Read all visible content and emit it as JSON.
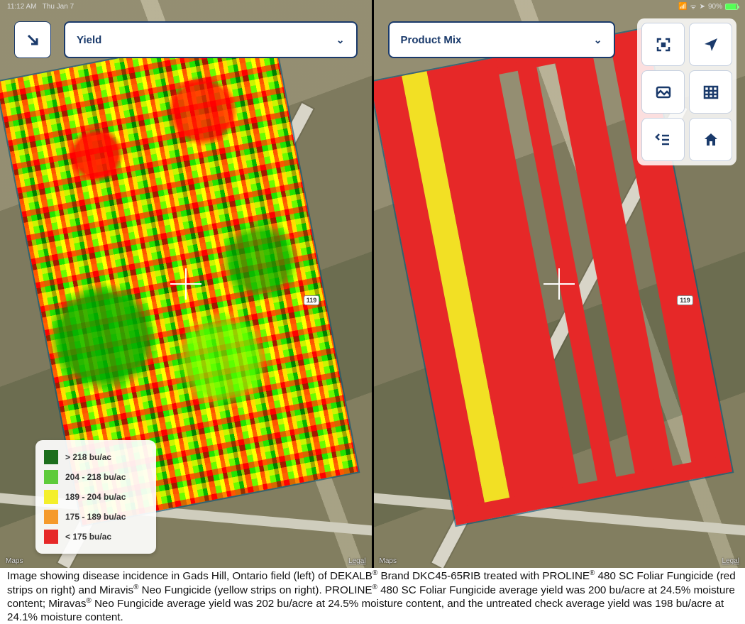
{
  "status": {
    "time": "11:12 AM",
    "date": "Thu Jan 7",
    "battery_pct": "90%"
  },
  "selectors": {
    "left_label": "Yield",
    "right_label": "Product Mix"
  },
  "route_marker": "119",
  "legend": {
    "rows": [
      {
        "color": "#1c6e1c",
        "label": "> 218 bu/ac"
      },
      {
        "color": "#5ecb3a",
        "label": "204 - 218 bu/ac"
      },
      {
        "color": "#f4ef2b",
        "label": "189 - 204 bu/ac"
      },
      {
        "color": "#f59a2b",
        "label": "175 - 189 bu/ac"
      },
      {
        "color": "#e62828",
        "label": "< 175 bu/ac"
      }
    ]
  },
  "attribution": {
    "brand": "Maps",
    "legal": "Legal"
  },
  "tools": {
    "collapse": "collapse",
    "fullscreen": "fullscreen",
    "locate": "locate",
    "screenshot": "screenshot",
    "table": "table",
    "layers": "layers",
    "home": "home"
  },
  "chart_data": {
    "type": "table",
    "title": "Fungicide trial average yield and moisture",
    "location": "Gads Hill, Ontario",
    "hybrid": "DEKALB Brand DKC45-65RIB",
    "series": [
      {
        "treatment": "PROLINE 480 SC Foliar Fungicide",
        "strip_color": "red",
        "avg_yield_bu_per_acre": 200,
        "moisture_pct": 24.5
      },
      {
        "treatment": "Miravas Neo Fungicide",
        "strip_color": "yellow",
        "avg_yield_bu_per_acre": 202,
        "moisture_pct": 24.5
      },
      {
        "treatment": "Untreated check",
        "strip_color": null,
        "avg_yield_bu_per_acre": 198,
        "moisture_pct": 24.1
      }
    ],
    "yield_legend_bu_per_ac": [
      {
        "min": 218,
        "max": null,
        "color": "#1c6e1c"
      },
      {
        "min": 204,
        "max": 218,
        "color": "#5ecb3a"
      },
      {
        "min": 189,
        "max": 204,
        "color": "#f4ef2b"
      },
      {
        "min": 175,
        "max": 189,
        "color": "#f59a2b"
      },
      {
        "min": null,
        "max": 175,
        "color": "#e62828"
      }
    ]
  },
  "caption_html": "Image showing disease incidence in Gads Hill, Ontario field (left) of DEKALB<sup>®</sup> Brand DKC45-65RIB treated with PROLINE<sup>®</sup> 480 SC Foliar Fungicide (red strips on right) and Miravis<sup>®</sup> Neo Fungicide (yellow strips on right). PROLINE<sup>®</sup> 480 SC Foliar Fungicide average yield was 200 bu/acre at 24.5% moisture content; Miravas<sup>®</sup> Neo Fungicide average yield was 202 bu/acre at 24.5% moisture content, and the untreated check average yield was 198 bu/acre at 24.1% moisture content."
}
